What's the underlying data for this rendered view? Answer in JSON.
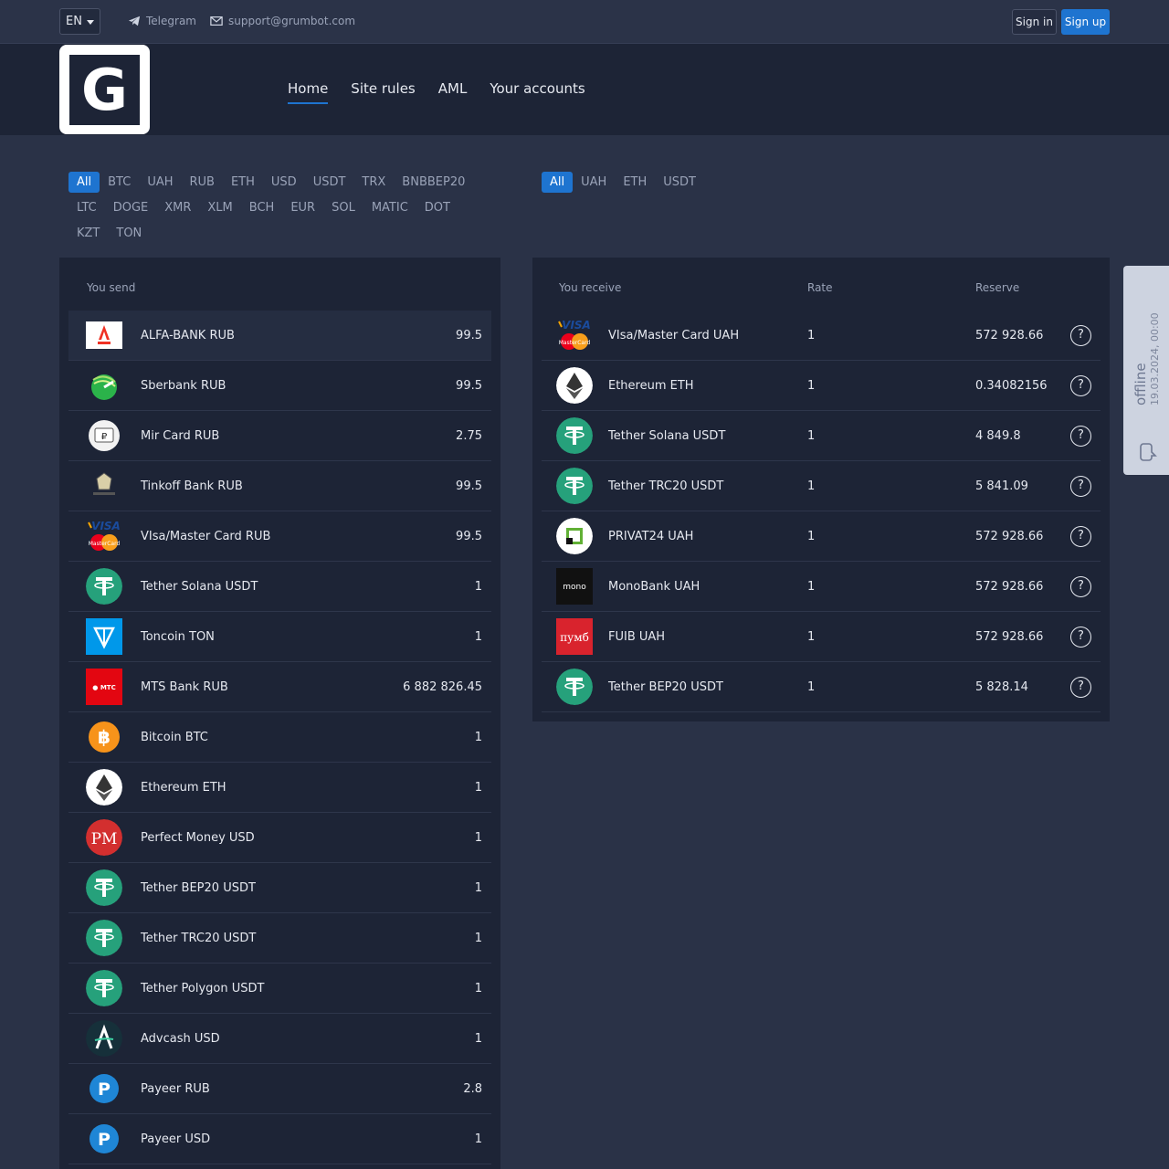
{
  "topbar": {
    "lang": "EN",
    "telegram": "Telegram",
    "email": "support@grumbot.com",
    "signin": "Sign in",
    "signup": "Sign up"
  },
  "header": {
    "logo_letter": "G",
    "nav": [
      "Home",
      "Site rules",
      "AML",
      "Your accounts"
    ]
  },
  "send_filters": [
    "All",
    "BTC",
    "UAH",
    "RUB",
    "ETH",
    "USD",
    "USDT",
    "TRX",
    "BNBBEP20",
    "LTC",
    "DOGE",
    "XMR",
    "XLM",
    "BCH",
    "EUR",
    "SOL",
    "MATIC",
    "DOT",
    "KZT",
    "TON"
  ],
  "receive_filters": [
    "All",
    "UAH",
    "ETH",
    "USDT"
  ],
  "send": {
    "header": "You send",
    "rows": [
      {
        "name": "ALFA-BANK RUB",
        "value": "99.5",
        "icon": "alfa-icon"
      },
      {
        "name": "Sberbank RUB",
        "value": "99.5",
        "icon": "sberbank-icon"
      },
      {
        "name": "Mir Card RUB",
        "value": "2.75",
        "icon": "mir-card-icon"
      },
      {
        "name": "Tinkoff Bank RUB",
        "value": "99.5",
        "icon": "tinkoff-icon"
      },
      {
        "name": "VIsa/Master Card RUB",
        "value": "99.5",
        "icon": "visa-mastercard-icon"
      },
      {
        "name": "Tether Solana USDT",
        "value": "1",
        "icon": "tether-icon"
      },
      {
        "name": "Toncoin TON",
        "value": "1",
        "icon": "toncoin-icon"
      },
      {
        "name": "MTS Bank RUB",
        "value": "6 882 826.45",
        "icon": "mts-bank-icon"
      },
      {
        "name": "Bitcoin BTC",
        "value": "1",
        "icon": "bitcoin-icon"
      },
      {
        "name": "Ethereum ETH",
        "value": "1",
        "icon": "ethereum-icon"
      },
      {
        "name": "Perfect Money USD",
        "value": "1",
        "icon": "perfect-money-icon"
      },
      {
        "name": "Tether BEP20 USDT",
        "value": "1",
        "icon": "tether-icon"
      },
      {
        "name": "Tether TRC20 USDT",
        "value": "1",
        "icon": "tether-icon"
      },
      {
        "name": "Tether Polygon USDT",
        "value": "1",
        "icon": "tether-icon"
      },
      {
        "name": "Advcash USD",
        "value": "1",
        "icon": "advcash-icon"
      },
      {
        "name": "Payeer RUB",
        "value": "2.8",
        "icon": "payeer-icon"
      },
      {
        "name": "Payeer USD",
        "value": "1",
        "icon": "payeer-icon"
      }
    ]
  },
  "receive": {
    "header_receive": "You receive",
    "header_rate": "Rate",
    "header_reserve": "Reserve",
    "help": "?",
    "rows": [
      {
        "name": "VIsa/Master Card UAH",
        "rate": "1",
        "reserve": "572 928.66",
        "icon": "visa-mastercard-icon"
      },
      {
        "name": "Ethereum ETH",
        "rate": "1",
        "reserve": "0.34082156",
        "icon": "ethereum-icon"
      },
      {
        "name": "Tether Solana USDT",
        "rate": "1",
        "reserve": "4 849.8",
        "icon": "tether-icon"
      },
      {
        "name": "Tether TRC20 USDT",
        "rate": "1",
        "reserve": "5 841.09",
        "icon": "tether-icon"
      },
      {
        "name": "PRIVAT24 UAH",
        "rate": "1",
        "reserve": "572 928.66",
        "icon": "privat24-icon"
      },
      {
        "name": "MonoBank UAH",
        "rate": "1",
        "reserve": "572 928.66",
        "icon": "monobank-icon"
      },
      {
        "name": "FUIB UAH",
        "rate": "1",
        "reserve": "572 928.66",
        "icon": "fuib-icon"
      },
      {
        "name": "Tether BEP20 USDT",
        "rate": "1",
        "reserve": "5 828.14",
        "icon": "tether-icon"
      }
    ]
  },
  "chat": {
    "status": "offline",
    "date": "19.03.2024, 00:00"
  },
  "colors": {
    "accent": "#1e74d0",
    "tether": "#26a17b",
    "bitcoin": "#f7931a",
    "alfa": "#ef3124"
  }
}
